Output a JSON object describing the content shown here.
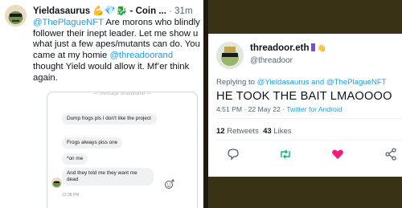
{
  "left_tweet": {
    "display_name": "Yieldasaurus",
    "name_emojis": "💪💎🐉",
    "name_suffix": "- Coin ...",
    "dot": "·",
    "time": "31m",
    "mention": "@ThePlagueNFT",
    "text_after_mention": " Are morons who blindly follower their inept leader. Let me show u what just a few apes/mutants can do. You came at my homie ",
    "mention2": "@threadoorand",
    "text_end": " thought Yield would allow it. Mf’er think again.",
    "embedded": {
      "deleted_label": "— message unavailable —",
      "messages": [
        "Dump frogs pls I don't like the project",
        "Frogs always piss one",
        "*on me",
        "And they told me they want me dead"
      ],
      "time": "12:38 PM"
    }
  },
  "right_tweet": {
    "display_name": "threadoor.eth",
    "hand_emoji": "👋",
    "handle": "@threadoor",
    "replying_label": "Replying to ",
    "replying_to": "@Yieldasaurus and @ThePlagueNFT",
    "text": "HE TOOK THE BAIT LMAOOOO",
    "time": "4:51 PM · 22 May 22 · ",
    "source": "Twitter for Android",
    "retweets_count": "12",
    "retweets_label": " Retweets",
    "likes_count": "43",
    "likes_label": " Likes"
  },
  "icons": {
    "reply": "comment-icon",
    "retweet": "retweet-icon",
    "like": "heart-icon",
    "share": "share-icon",
    "react": "add-reaction-icon"
  },
  "colors": {
    "twitter_blue": "#1d9bf0",
    "retweet_green": "#00ba7c",
    "like_pink": "#f91880",
    "badge_purple": "#7a4bd8",
    "right_background": "#3a3214"
  }
}
